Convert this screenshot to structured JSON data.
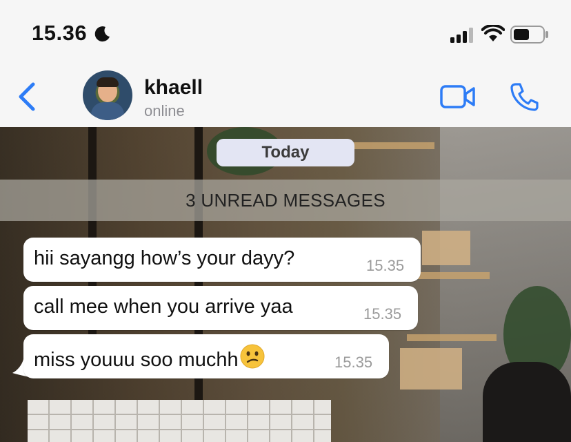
{
  "status_bar": {
    "time": "15.36",
    "icons": [
      "moon-icon",
      "cellular-signal-icon",
      "wifi-icon",
      "battery-icon"
    ]
  },
  "header": {
    "contact_name": "khaell",
    "contact_status": "online",
    "icons": [
      "back-chevron-icon",
      "video-camera-icon",
      "phone-icon"
    ],
    "accent_color": "#2d7cf6"
  },
  "chat": {
    "date_label": "Today",
    "unread_label": "3 UNREAD MESSAGES",
    "messages": [
      {
        "text": "hii sayangg how’s your dayy?",
        "time": "15.35"
      },
      {
        "text": "call mee when you arrive yaa",
        "time": "15.35"
      },
      {
        "text": "miss youuu soo muchh",
        "emoji": "confused-face",
        "time": "15.35"
      }
    ]
  }
}
